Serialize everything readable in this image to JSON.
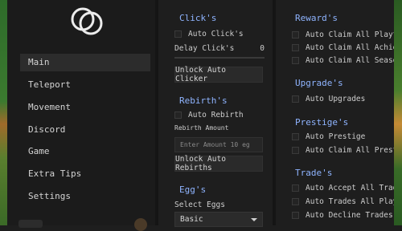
{
  "sidebar": {
    "nav": [
      {
        "label": "Main",
        "active": true
      },
      {
        "label": "Teleport"
      },
      {
        "label": "Movement"
      },
      {
        "label": "Discord"
      },
      {
        "label": "Game"
      },
      {
        "label": "Extra Tips"
      },
      {
        "label": "Settings"
      }
    ]
  },
  "main": {
    "clicks": {
      "title": "Click's",
      "auto_clicks": "Auto Click's",
      "delay_label": "Delay Click's",
      "delay_value": "0",
      "delay_level": 0,
      "unlock_button": "Unlock Auto Clicker"
    },
    "rebirths": {
      "title": "Rebirth's",
      "auto_rebirth": "Auto Rebirth",
      "amount_label": "Rebirth Amount",
      "amount_placeholder": "Enter Amount 10 eg",
      "unlock_button": "Unlock Auto Rebirths"
    },
    "eggs": {
      "title": "Egg's",
      "select_label": "Select Eggs",
      "select_value": "Basic"
    }
  },
  "right": {
    "reward": {
      "title": "Reward's",
      "items": [
        "Auto Claim All Playtime",
        "Auto Claim All Achievements",
        "Auto Claim All Seasons"
      ]
    },
    "upgrades": {
      "title": "Upgrade's",
      "items": [
        "Auto Upgrades"
      ]
    },
    "prestige": {
      "title": "Prestige's",
      "items": [
        "Auto Prestige",
        "Auto Claim All Prestige"
      ]
    },
    "trades": {
      "title": "Trade's",
      "items": [
        "Auto Accept All Trades",
        "Auto Trades All Players",
        "Auto Decline Trades"
      ]
    }
  },
  "colors": {
    "accent": "#8fb4ff",
    "panel": "#1e1e1e",
    "sidebar": "#1b1b1b"
  }
}
